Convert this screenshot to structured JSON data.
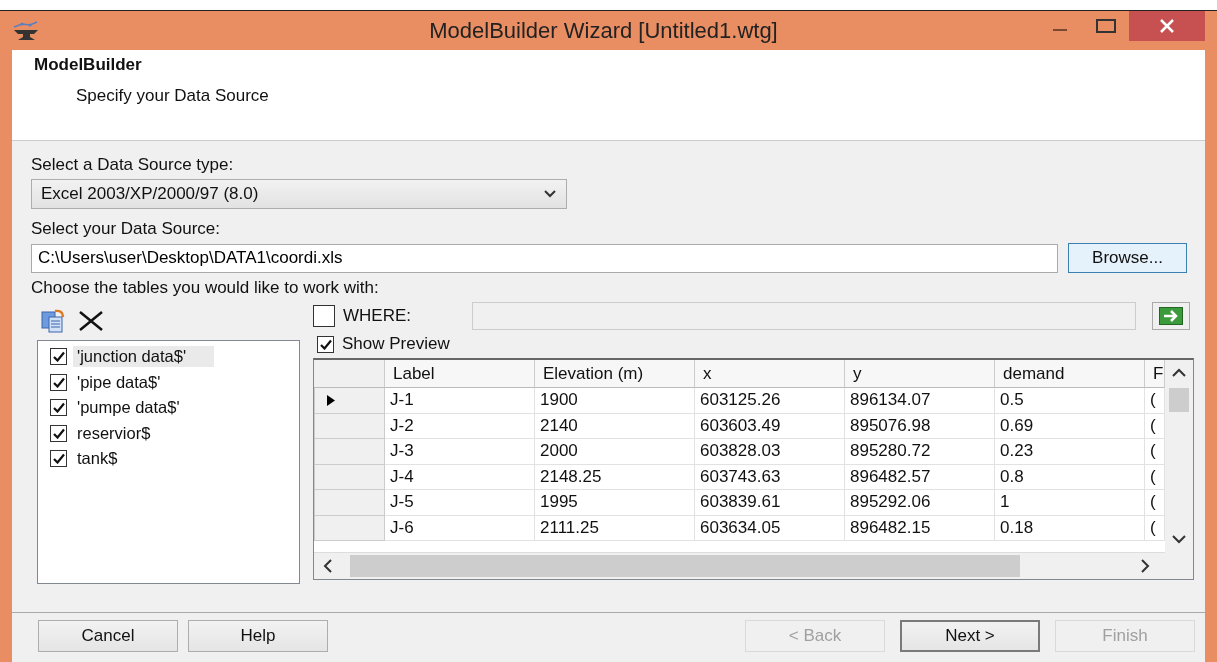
{
  "window": {
    "title": "ModelBuilder Wizard [Untitled1.wtg]"
  },
  "header": {
    "title": "ModelBuilder",
    "subtitle": "Specify your Data Source"
  },
  "source_type": {
    "label": "Select a Data Source type:",
    "value": "Excel 2003/XP/2000/97 (8.0)"
  },
  "data_source": {
    "label": "Select your Data Source:",
    "value": "C:\\Users\\user\\Desktop\\DATA1\\coordi.xls",
    "browse": "Browse..."
  },
  "tables_label": "Choose the tables you would like to work with:",
  "tables": [
    {
      "label": "'junction data$'",
      "checked": true,
      "selected": true
    },
    {
      "label": "'pipe data$'",
      "checked": true,
      "selected": false
    },
    {
      "label": "'pumpe data$'",
      "checked": true,
      "selected": false
    },
    {
      "label": "reservior$",
      "checked": true,
      "selected": false
    },
    {
      "label": "tank$",
      "checked": true,
      "selected": false
    }
  ],
  "where": {
    "label": "WHERE:",
    "checked": false
  },
  "show_preview": {
    "label": "Show Preview",
    "checked": true
  },
  "grid": {
    "columns": [
      "Label",
      "Elevation (m)",
      "x",
      "y",
      "demand",
      "F"
    ],
    "rows": [
      {
        "cells": [
          "J-1",
          "1900",
          "603125.26",
          "896134.07",
          "0.5",
          "("
        ],
        "selected": true
      },
      {
        "cells": [
          "J-2",
          "2140",
          "603603.49",
          "895076.98",
          "0.69",
          "("
        ],
        "selected": false
      },
      {
        "cells": [
          "J-3",
          "2000",
          "603828.03",
          "895280.72",
          "0.23",
          "("
        ],
        "selected": false
      },
      {
        "cells": [
          "J-4",
          "2148.25",
          "603743.63",
          "896482.57",
          "0.8",
          "("
        ],
        "selected": false
      },
      {
        "cells": [
          "J-5",
          "1995",
          "603839.61",
          "895292.06",
          "1",
          "("
        ],
        "selected": false
      },
      {
        "cells": [
          "J-6",
          "2111.25",
          "603634.05",
          "896482.15",
          "0.18",
          "("
        ],
        "selected": false
      }
    ]
  },
  "left_buttons": [
    {
      "label": "Cancel",
      "disabled": false,
      "default": false
    },
    {
      "label": "Help",
      "disabled": false,
      "default": false
    }
  ],
  "right_buttons": [
    {
      "label": "< Back",
      "disabled": true,
      "default": false
    },
    {
      "label": "Next >",
      "disabled": false,
      "default": true
    },
    {
      "label": "Finish",
      "disabled": true,
      "default": false
    }
  ]
}
